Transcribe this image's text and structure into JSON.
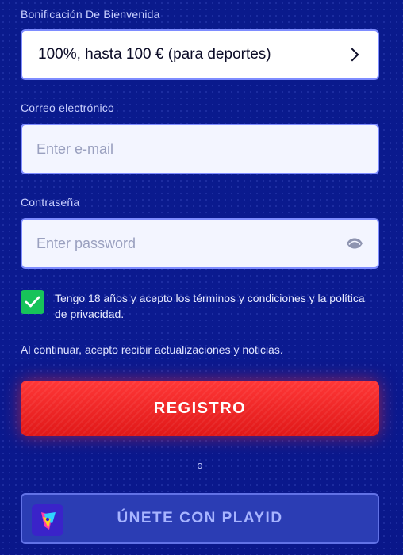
{
  "bonus": {
    "label": "Bonificación De Bienvenida",
    "value": "100%, hasta 100 € (para deportes)"
  },
  "email": {
    "label": "Correo electrónico",
    "placeholder": "Enter e-mail",
    "value": ""
  },
  "password": {
    "label": "Contraseña",
    "placeholder": "Enter password",
    "value": ""
  },
  "terms": {
    "checked": true,
    "text": "Tengo 18 años y acepto los términos y condiciones y la política de privacidad."
  },
  "notice": "Al continuar, acepto recibir actualizaciones y noticias.",
  "register_button": "REGISTRO",
  "divider_text": "o",
  "playid_button": "ÚNETE CON PLAYID",
  "icons": {
    "bonus_arrow": "chevron-right-icon",
    "password_toggle": "eye-icon",
    "checkbox": "checkmark-icon",
    "playid": "playid-logo-icon"
  },
  "colors": {
    "background": "#0a1a8c",
    "register": "#ff3737",
    "checkbox": "#17c35a",
    "field_border": "#7e8cff"
  }
}
